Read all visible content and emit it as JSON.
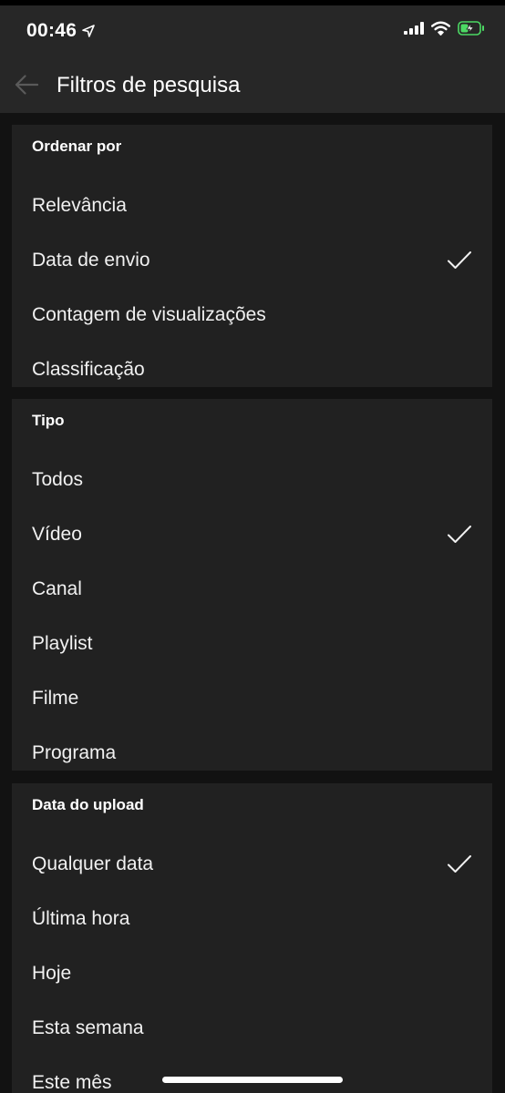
{
  "status_bar": {
    "time": "00:46",
    "icons": [
      "location-arrow-icon",
      "cellular-signal-icon",
      "wifi-icon",
      "battery-charging-icon"
    ],
    "battery_color": "#4cd964"
  },
  "app_bar": {
    "back_icon": "arrow-left-icon",
    "title": "Filtros de pesquisa"
  },
  "sections": [
    {
      "header": "Ordenar por",
      "options": [
        {
          "label": "Relevância",
          "selected": false
        },
        {
          "label": "Data de envio",
          "selected": true
        },
        {
          "label": "Contagem de visualizações",
          "selected": false
        },
        {
          "label": "Classificação",
          "selected": false
        }
      ]
    },
    {
      "header": "Tipo",
      "options": [
        {
          "label": "Todos",
          "selected": false
        },
        {
          "label": "Vídeo",
          "selected": true
        },
        {
          "label": "Canal",
          "selected": false
        },
        {
          "label": "Playlist",
          "selected": false
        },
        {
          "label": "Filme",
          "selected": false
        },
        {
          "label": "Programa",
          "selected": false
        }
      ]
    },
    {
      "header": "Data do upload",
      "options": [
        {
          "label": "Qualquer data",
          "selected": true
        },
        {
          "label": "Última hora",
          "selected": false
        },
        {
          "label": "Hoje",
          "selected": false
        },
        {
          "label": "Esta semana",
          "selected": false
        },
        {
          "label": "Este mês",
          "selected": false
        }
      ]
    }
  ],
  "colors": {
    "background": "#121212",
    "bar": "#272727",
    "card": "#212121",
    "text": "#ffffff"
  }
}
